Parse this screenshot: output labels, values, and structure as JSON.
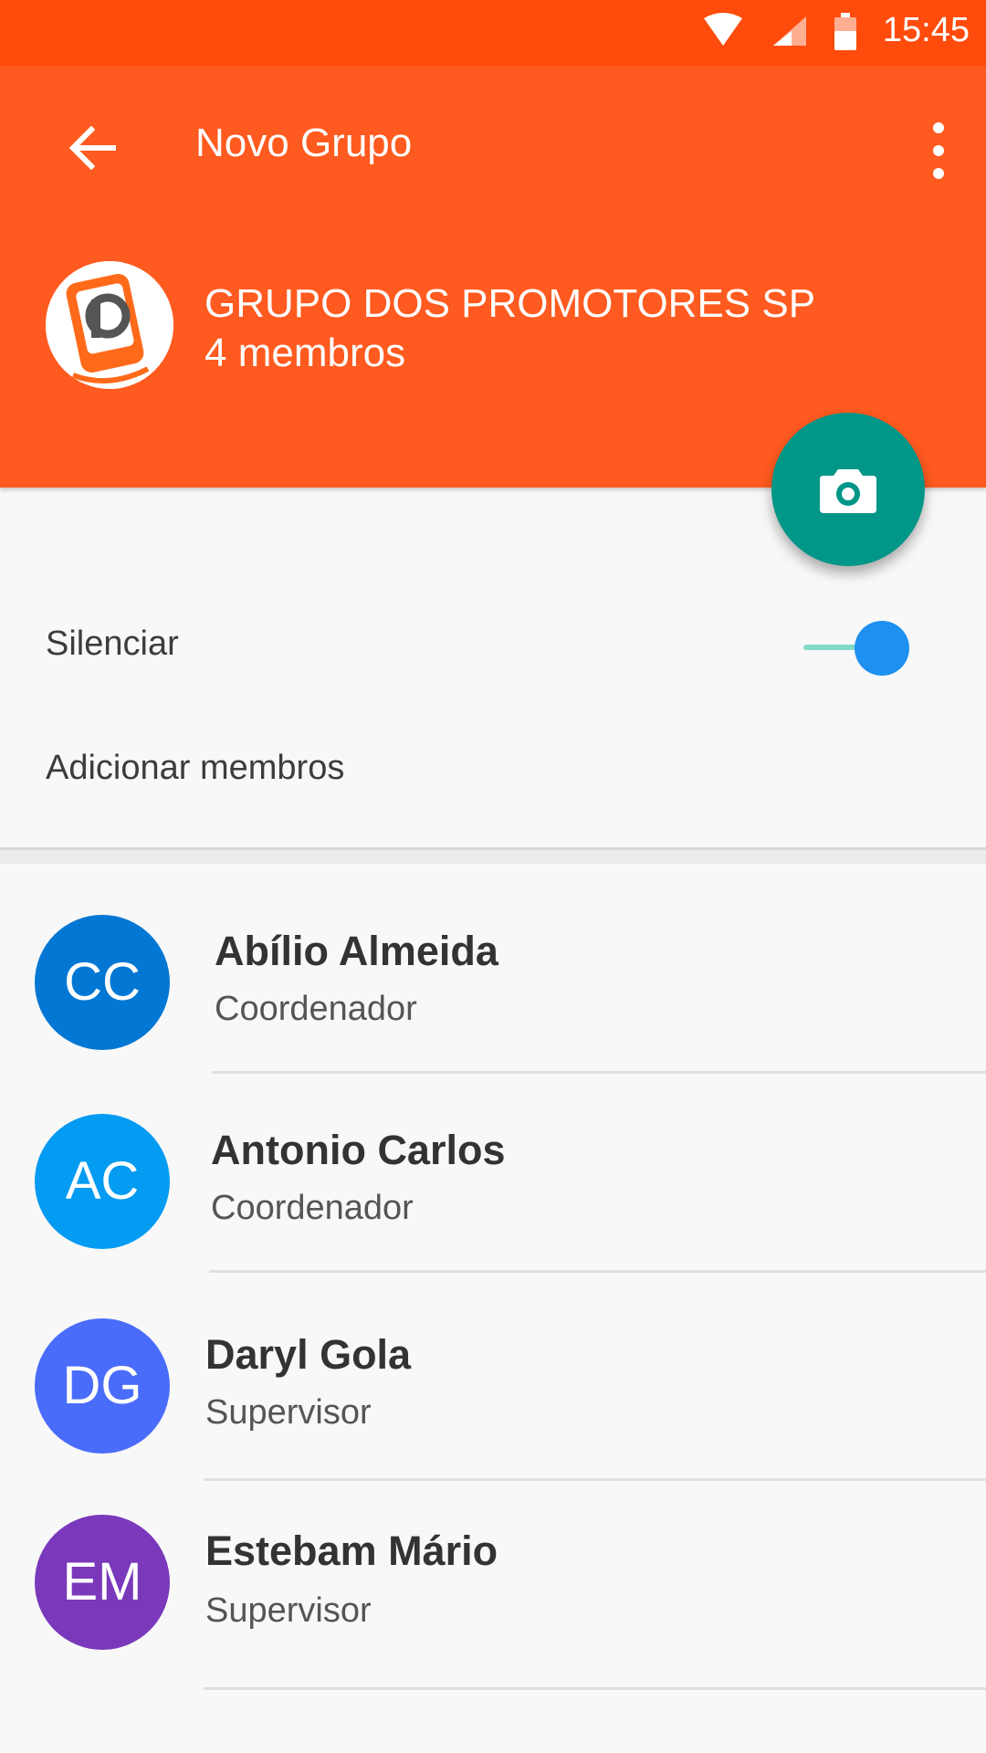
{
  "status_bar": {
    "time": "15:45",
    "icons": [
      "wifi-icon",
      "signal-icon",
      "battery-icon"
    ]
  },
  "app_bar": {
    "title": "Novo Grupo",
    "back_icon": "arrow-left-icon",
    "menu_icon": "more-vert-icon"
  },
  "group": {
    "name": "GRUPO DOS PROMOTORES SP",
    "members_count": "4 membros"
  },
  "settings": {
    "mute_label": "Silenciar",
    "mute_enabled": true,
    "add_members_label": "Adicionar membros"
  },
  "members": [
    {
      "initials": "CC",
      "name": "Abílio Almeida",
      "role": "Coordenador",
      "color": "#0277d4"
    },
    {
      "initials": "AC",
      "name": "Antonio Carlos",
      "role": "Coordenador",
      "color": "#049bf2"
    },
    {
      "initials": "DG",
      "name": "Daryl Gola",
      "role": "Supervisor",
      "color": "#4a6cfb"
    },
    {
      "initials": "EM",
      "name": "Estebam Mário",
      "role": "Supervisor",
      "color": "#7a38bb"
    }
  ],
  "colors": {
    "status_bar": "#ff4c0c",
    "app_bar": "#ff5a1f",
    "fab": "#009688",
    "toggle_thumb": "#1e90f0",
    "toggle_track": "#80dbc8"
  }
}
